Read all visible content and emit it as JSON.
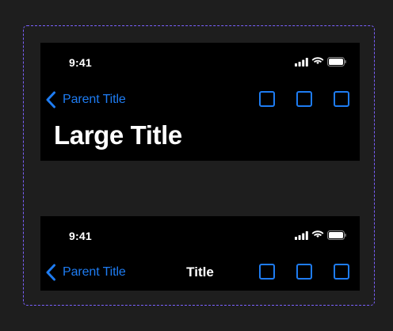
{
  "large_nav": {
    "status": {
      "time": "9:41"
    },
    "back_label": "Parent Title",
    "large_title": "Large Title",
    "actions": [
      "action-1",
      "action-2",
      "action-3"
    ]
  },
  "small_nav": {
    "status": {
      "time": "9:41"
    },
    "back_label": "Parent Title",
    "title": "Title",
    "actions": [
      "action-1",
      "action-2",
      "action-3"
    ]
  },
  "colors": {
    "background": "#1e1e1e",
    "navbar": "#000000",
    "accent": "#1e7cf2",
    "frame_border": "#7b61ff",
    "text": "#ffffff"
  },
  "icons": {
    "signal": "cellular-signal-icon",
    "wifi": "wifi-icon",
    "battery": "battery-icon",
    "back": "chevron-left-icon"
  }
}
